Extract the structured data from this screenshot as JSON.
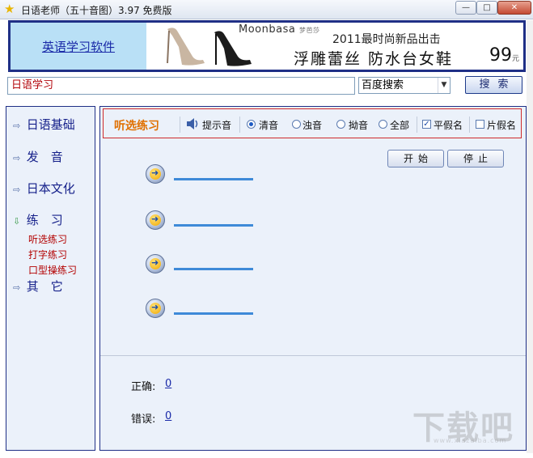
{
  "window": {
    "title": "日语老师（五十音图）3.97 免费版",
    "min_glyph": "—",
    "max_glyph": "□",
    "close_glyph": "✕"
  },
  "banner": {
    "link_label": "英语学习软件",
    "ad_brand": "Moonbasa",
    "ad_brand_sub": "梦芭莎",
    "ad_line1": "2011最时尚新品出击",
    "ad_line2": "浮雕蕾丝  防水台女鞋",
    "ad_price": "99",
    "ad_price_unit": "元"
  },
  "search": {
    "value": "日语学习",
    "engine": "百度搜索",
    "button_label": "搜索"
  },
  "sidebar": {
    "items": [
      {
        "label": "日语基础"
      },
      {
        "label": "发　音"
      },
      {
        "label": "日本文化"
      },
      {
        "label": "练　习"
      },
      {
        "label": "其　它"
      }
    ],
    "sub_items": [
      {
        "label": "听选练习"
      },
      {
        "label": "打字练习"
      },
      {
        "label": "口型操练习"
      }
    ]
  },
  "toolbar": {
    "title": "听选练习",
    "sound_label": "提示音",
    "radios": [
      {
        "label": "清音",
        "checked": true
      },
      {
        "label": "浊音",
        "checked": false
      },
      {
        "label": "拗音",
        "checked": false
      },
      {
        "label": "全部",
        "checked": false
      }
    ],
    "checkboxes": [
      {
        "label": "平假名",
        "checked": true
      },
      {
        "label": "片假名",
        "checked": false
      }
    ]
  },
  "controls": {
    "start_label": "开始",
    "stop_label": "停止"
  },
  "stats": {
    "correct_label": "正确:",
    "correct_value": "0",
    "wrong_label": "错误:",
    "wrong_value": "0"
  },
  "watermark": {
    "text": "下载吧",
    "sub": "www.xiazaiba.com"
  },
  "colors": {
    "frame": "#1f2f86",
    "accent_orange": "#e07000",
    "sub_item_red": "#b30000",
    "panel_bg": "#ebf1fa"
  }
}
